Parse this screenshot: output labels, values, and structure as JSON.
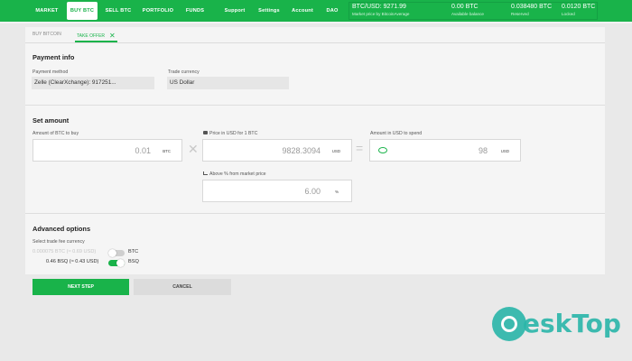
{
  "nav": {
    "items": [
      "MARKET",
      "BUY BTC",
      "SELL BTC",
      "PORTFOLIO",
      "FUNDS",
      "Support",
      "Settings",
      "Account",
      "DAO"
    ],
    "active_index": 1
  },
  "stats": {
    "price_value": "BTC/USD: 9271.99",
    "price_label": "Market price by BitcoinAverage",
    "available_value": "0.00 BTC",
    "available_label": "Available balance",
    "reserved_value": "0.038480 BTC",
    "reserved_label": "Reserved",
    "locked_value": "0.0120 BTC",
    "locked_label": "Locked"
  },
  "subtabs": {
    "buy_bitcoin": "BUY BITCOIN",
    "take_offer": "TAKE OFFER",
    "close_symbol": "✕"
  },
  "payment": {
    "title": "Payment info",
    "method_label": "Payment method",
    "method_value": "Zelle (ClearXchange): 917251...",
    "currency_label": "Trade currency",
    "currency_value": "US Dollar"
  },
  "amount": {
    "title": "Set amount",
    "btc_label": "Amount of BTC to buy",
    "btc_value": "0.01",
    "btc_unit": "BTC",
    "times_symbol": "✕",
    "price_label": "Price in USD for 1 BTC",
    "price_value": "9828.3094",
    "price_unit": "USD",
    "equals_symbol": "=",
    "spend_label": "Amount in USD to spend",
    "spend_value": "98",
    "spend_unit": "USD",
    "pct_label": "Above % from market price",
    "pct_value": "6.00",
    "pct_unit": "%"
  },
  "advanced": {
    "title": "Advanced options",
    "fee_label": "Select trade fee currency",
    "btc_fee": "0.000075 BTC (≈ 0.69 USD)",
    "btc_currency": "BTC",
    "bsq_fee": "0.46 BSQ (≈ 0.43 USD)",
    "bsq_currency": "BSQ",
    "bsq_selected": true
  },
  "buttons": {
    "next": "NEXT STEP",
    "cancel": "CANCEL"
  },
  "watermark": {
    "text": "eskTop"
  },
  "colors": {
    "accent": "#19b34a",
    "watermark": "#2ab6a9"
  }
}
